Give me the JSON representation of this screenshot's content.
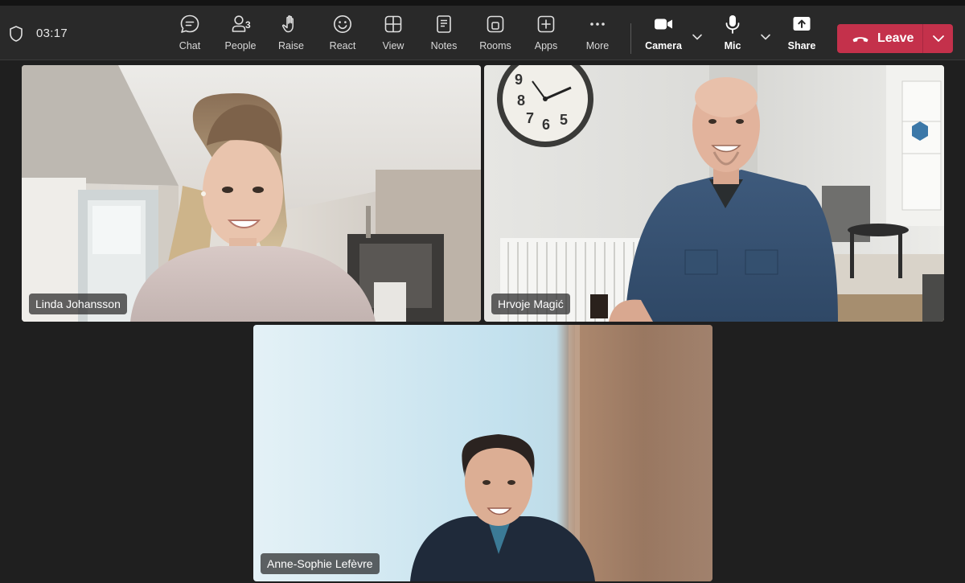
{
  "call": {
    "timer": "03:17"
  },
  "toolbar": {
    "chat": {
      "label": "Chat",
      "icon": "chat-icon"
    },
    "people": {
      "label": "People",
      "count": "3",
      "icon": "people-icon"
    },
    "raise": {
      "label": "Raise",
      "icon": "hand-icon"
    },
    "react": {
      "label": "React",
      "icon": "smiley-icon"
    },
    "view": {
      "label": "View",
      "icon": "grid-icon"
    },
    "notes": {
      "label": "Notes",
      "icon": "notes-icon"
    },
    "rooms": {
      "label": "Rooms",
      "icon": "rooms-icon"
    },
    "apps": {
      "label": "Apps",
      "icon": "plus-icon"
    },
    "more": {
      "label": "More",
      "icon": "ellipsis-icon"
    },
    "camera": {
      "label": "Camera",
      "icon": "camera-icon"
    },
    "mic": {
      "label": "Mic",
      "icon": "microphone-icon"
    },
    "share": {
      "label": "Share",
      "icon": "share-upload-icon"
    },
    "leave": {
      "label": "Leave",
      "icon": "hangup-phone-icon",
      "color": "#c4314b"
    }
  },
  "participants": [
    {
      "name": "Linda Johansson"
    },
    {
      "name": "Hrvoje Magić"
    },
    {
      "name": "Anne-Sophie Lefèvre"
    }
  ],
  "theme": {
    "background": "#1f1f1f",
    "toolbar": "#292929",
    "leave_red": "#c4314b"
  }
}
